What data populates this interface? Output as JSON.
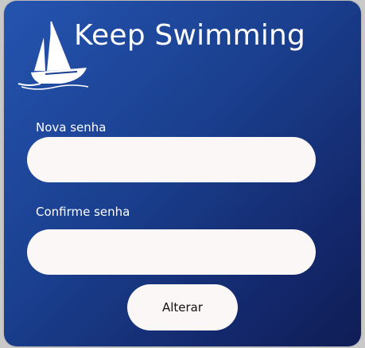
{
  "app": {
    "title": "Keep Swimming",
    "logo_icon": "sailboat-icon"
  },
  "form": {
    "new_password_label": "Nova senha",
    "new_password_value": "",
    "confirm_password_label": "Confirme senha",
    "confirm_password_value": "",
    "submit_label": "Alterar"
  },
  "colors": {
    "card_gradient_start": "#2554b0",
    "card_gradient_end": "#0f1d55",
    "field_background": "#fcf7f7",
    "text_light": "#ffffff"
  }
}
